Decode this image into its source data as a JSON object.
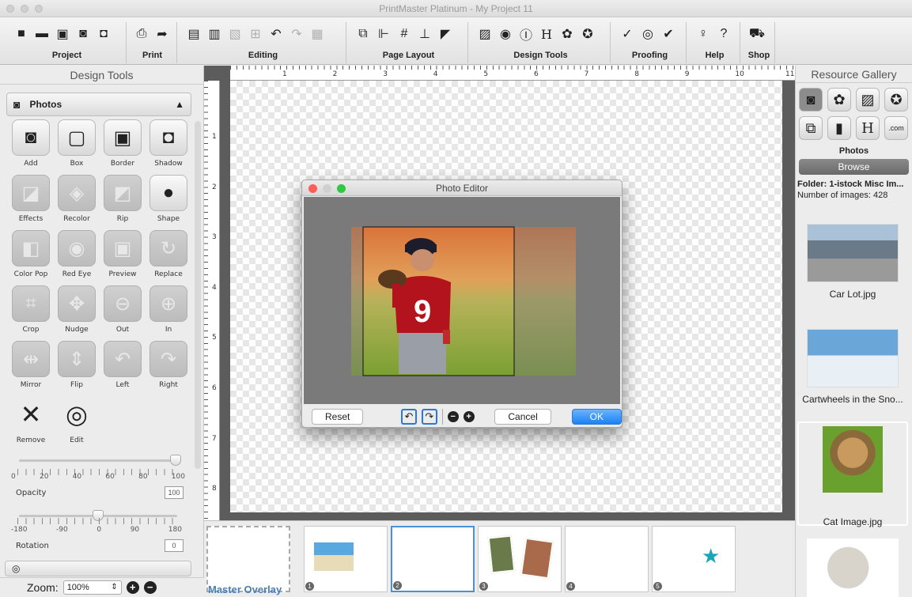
{
  "window": {
    "title": "PrintMaster Platinum - My Project 11"
  },
  "toolbar": {
    "groups": [
      {
        "label": "Project"
      },
      {
        "label": "Print"
      },
      {
        "label": "Editing"
      },
      {
        "label": "Page Layout"
      },
      {
        "label": "Design Tools"
      },
      {
        "label": "Proofing"
      },
      {
        "label": "Help"
      },
      {
        "label": "Shop"
      }
    ]
  },
  "left_panel": {
    "title": "Design Tools",
    "section_label": "Photos",
    "tools": [
      {
        "label": "Add",
        "icon": "camera-icon",
        "enabled": true
      },
      {
        "label": "Box",
        "icon": "box-frame-icon",
        "enabled": true
      },
      {
        "label": "Border",
        "icon": "border-frame-icon",
        "enabled": true
      },
      {
        "label": "Shadow",
        "icon": "shadow-frame-icon",
        "enabled": true
      },
      {
        "label": "Effects",
        "icon": "effects-icon",
        "enabled": false
      },
      {
        "label": "Recolor",
        "icon": "recolor-drops-icon",
        "enabled": false
      },
      {
        "label": "Rip",
        "icon": "rip-icon",
        "enabled": false
      },
      {
        "label": "Shape",
        "icon": "shape-person-icon",
        "enabled": true
      },
      {
        "label": "Color Pop",
        "icon": "color-pop-icon",
        "enabled": false
      },
      {
        "label": "Red Eye",
        "icon": "red-eye-icon",
        "enabled": false
      },
      {
        "label": "Preview",
        "icon": "preview-icon",
        "enabled": false
      },
      {
        "label": "Replace",
        "icon": "replace-arrows-icon",
        "enabled": false
      },
      {
        "label": "Crop",
        "icon": "crop-icon",
        "enabled": false
      },
      {
        "label": "Nudge",
        "icon": "nudge-arrows-icon",
        "enabled": false
      },
      {
        "label": "Out",
        "icon": "zoom-out-icon",
        "enabled": false
      },
      {
        "label": "In",
        "icon": "zoom-in-icon",
        "enabled": false
      },
      {
        "label": "Mirror",
        "icon": "mirror-icon",
        "enabled": false
      },
      {
        "label": "Flip",
        "icon": "flip-icon",
        "enabled": false
      },
      {
        "label": "Left",
        "icon": "rotate-left-icon",
        "enabled": false
      },
      {
        "label": "Right",
        "icon": "rotate-right-icon",
        "enabled": false
      },
      {
        "label": "Remove",
        "icon": "remove-x-icon",
        "enabled": true
      },
      {
        "label": "Edit",
        "icon": "edit-aperture-icon",
        "enabled": true
      }
    ],
    "opacity": {
      "label": "Opacity",
      "ticks": [
        "0",
        "20",
        "40",
        "60",
        "80",
        "100"
      ],
      "value": "100",
      "level": 1.0
    },
    "rotation": {
      "label": "Rotation",
      "ticks": [
        "-180",
        "-90",
        "0",
        "90",
        "180"
      ],
      "value": "0",
      "level": 0.5
    }
  },
  "zoom": {
    "label": "Zoom:",
    "value": "100%"
  },
  "ruler": {
    "horizontal": [
      "1",
      "2",
      "3",
      "4",
      "5",
      "6",
      "7",
      "8",
      "9",
      "10",
      "11"
    ],
    "vertical": [
      "1",
      "2",
      "3",
      "4",
      "5",
      "6",
      "7",
      "8"
    ]
  },
  "photo_editor": {
    "title": "Photo Editor",
    "buttons": {
      "reset": "Reset",
      "cancel": "Cancel",
      "ok": "OK"
    },
    "jersey_number": "9"
  },
  "resource_gallery": {
    "title": "Resource Gallery",
    "category_label": "Photos",
    "browse_label": "Browse",
    "folder": "Folder: 1-istock Misc Im...",
    "count": "Number of images: 428",
    "items": [
      {
        "name": "Car Lot.jpg"
      },
      {
        "name": "Cartwheels in the Sno..."
      },
      {
        "name": "Cat Image.jpg"
      }
    ]
  },
  "page_strip": {
    "master_label": "Master Overlay",
    "pages": [
      "1",
      "2",
      "3",
      "4",
      "5"
    ]
  },
  "colors": {
    "accent": "#1a82f7",
    "selected_page": "#4a90d9",
    "star": "#1aa5b8"
  }
}
